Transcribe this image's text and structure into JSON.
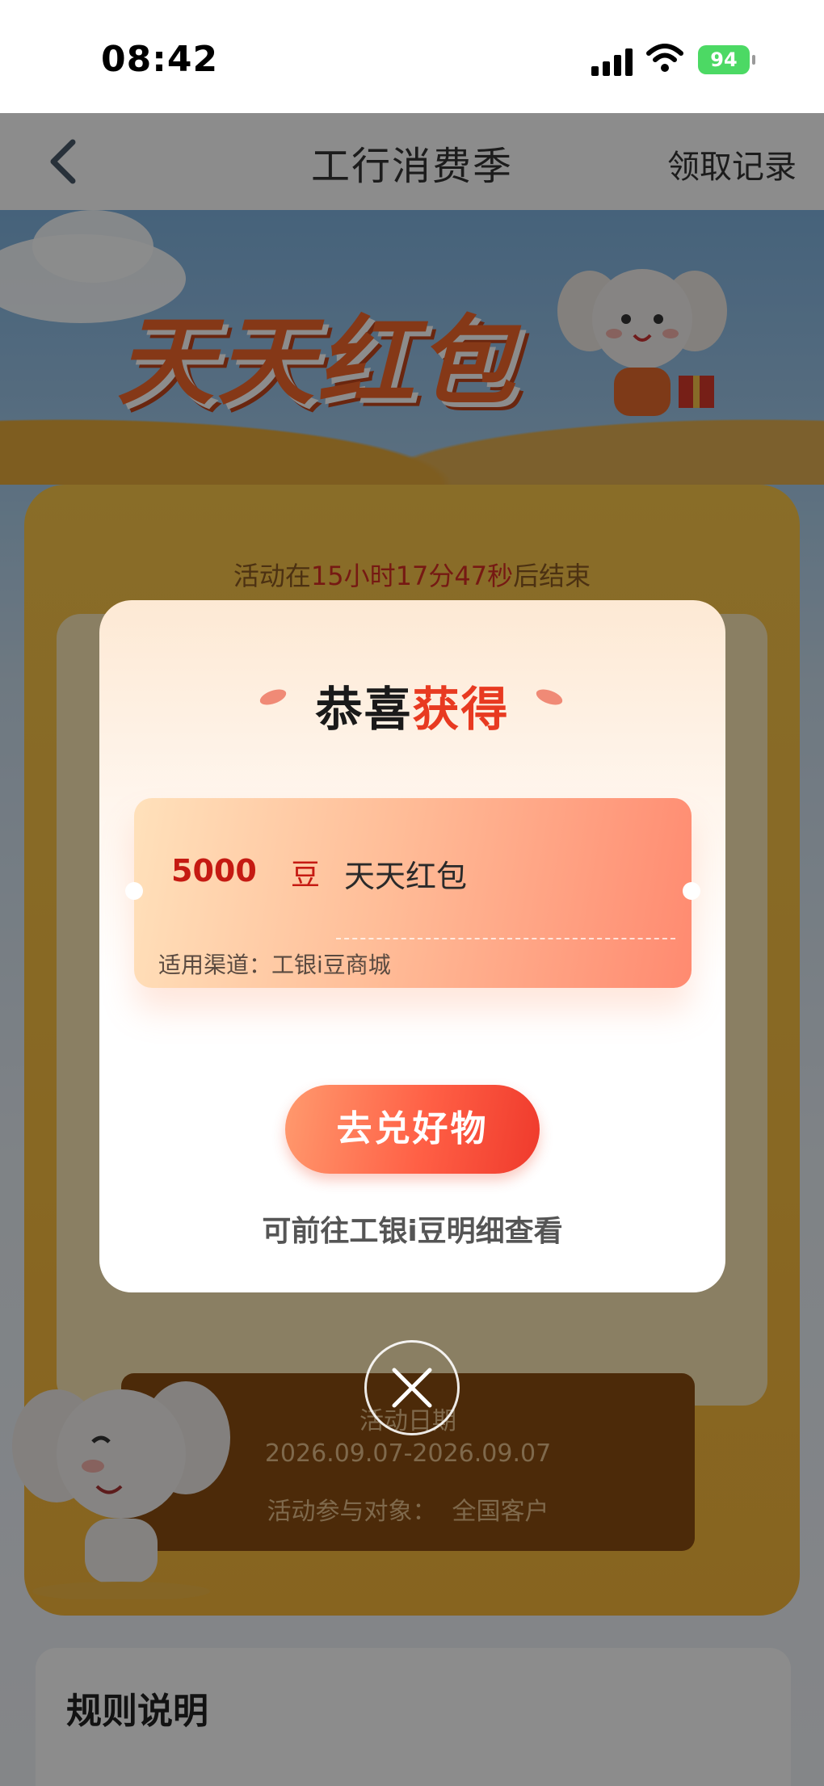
{
  "status_bar": {
    "time": "08:42",
    "battery": "94"
  },
  "nav": {
    "title": "工行消费季",
    "right_label": "领取记录"
  },
  "banner": {
    "title": "天天红包"
  },
  "activity": {
    "countdown_prefix": "活动在",
    "countdown_time": "15小时17分47秒",
    "countdown_suffix": "后结束",
    "date_label": "活动日期",
    "date_range": "2026.09.07-2026.09.07",
    "target_label": "活动参与对象：",
    "target_value": "全国客户"
  },
  "rules": {
    "title": "规则说明"
  },
  "modal": {
    "title_part1": "恭喜",
    "title_part2": "获得",
    "coupon": {
      "amount": "5000",
      "unit": "豆",
      "name": "天天红包",
      "channel": "适用渠道：工银i豆商城"
    },
    "cta_label": "去兑好物",
    "hint": "可前往工银i豆明细查看"
  },
  "colors": {
    "accent": "#e83a21",
    "cta": "#ff5f45",
    "board": "#f6b73a"
  }
}
